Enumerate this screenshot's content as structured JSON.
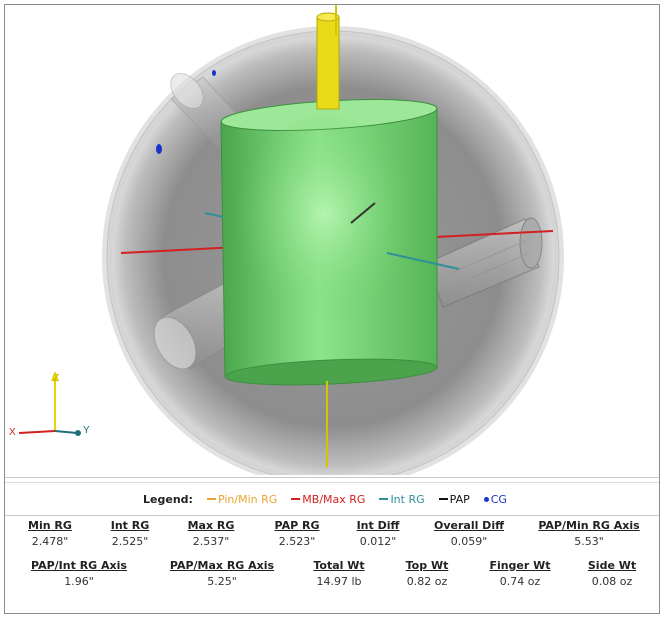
{
  "axes": {
    "z": "Z",
    "x": "X",
    "y": "Y"
  },
  "legend": {
    "title": "Legend:",
    "items": [
      {
        "label": "Pin/Min RG",
        "color": "#e8a630",
        "marker": "line"
      },
      {
        "label": "MB/Max RG",
        "color": "#d32020",
        "marker": "line"
      },
      {
        "label": "Int RG",
        "color": "#2f8f9a",
        "marker": "line"
      },
      {
        "label": "PAP",
        "color": "#111111",
        "marker": "line"
      },
      {
        "label": "CG",
        "color": "#1a36c8",
        "marker": "dot"
      }
    ]
  },
  "stats": {
    "min_rg": {
      "label": "Min RG",
      "value": "2.478\""
    },
    "int_rg": {
      "label": "Int RG",
      "value": "2.525\""
    },
    "max_rg": {
      "label": "Max RG",
      "value": "2.537\""
    },
    "pap_rg": {
      "label": "PAP RG",
      "value": "2.523\""
    },
    "int_diff": {
      "label": "Int Diff",
      "value": "0.012\""
    },
    "overall_diff": {
      "label": "Overall Diff",
      "value": "0.059\""
    },
    "pap_min_axis": {
      "label": "PAP/Min RG Axis",
      "value": "5.53\""
    },
    "pap_int_axis": {
      "label": "PAP/Int RG Axis",
      "value": "1.96\""
    },
    "pap_max_axis": {
      "label": "PAP/Max RG Axis",
      "value": "5.25\""
    },
    "total_wt": {
      "label": "Total Wt",
      "value": "14.97 lb"
    },
    "top_wt": {
      "label": "Top Wt",
      "value": "0.82 oz"
    },
    "finger_wt": {
      "label": "Finger Wt",
      "value": "0.74 oz"
    },
    "side_wt": {
      "label": "Side Wt",
      "value": "0.08 oz"
    }
  }
}
